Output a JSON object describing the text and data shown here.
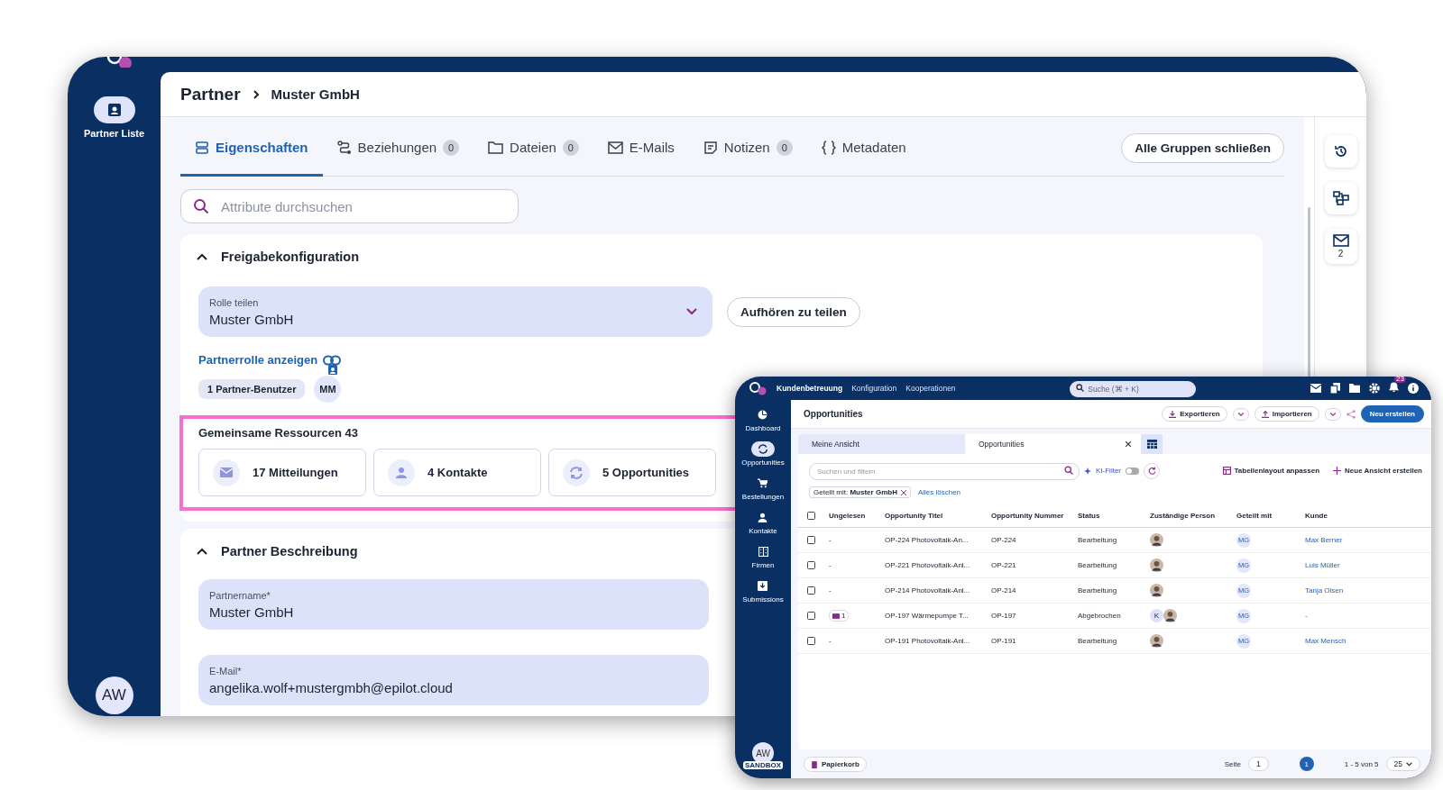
{
  "main": {
    "sidebar": {
      "items": [
        {
          "label": "Partner Liste",
          "selected": true
        }
      ],
      "avatar": "AW"
    },
    "breadcrumb": {
      "root": "Partner",
      "current": "Muster GmbH"
    },
    "tabs": [
      {
        "kind": "list",
        "label": "Eigenschaften",
        "selected": true
      },
      {
        "kind": "relations",
        "label": "Beziehungen",
        "count": "0",
        "selected": false
      },
      {
        "kind": "folder",
        "label": "Dateien",
        "count": "0",
        "selected": false
      },
      {
        "kind": "mail",
        "label": "E-Mails",
        "selected": false
      },
      {
        "kind": "note",
        "label": "Notizen",
        "count": "0",
        "selected": false
      },
      {
        "kind": "braces",
        "label": "Metadaten",
        "selected": false
      }
    ],
    "collapse_button": "Alle Gruppen schließen",
    "search": {
      "placeholder": "Attribute durchsuchen"
    },
    "sharing": {
      "title": "Freigabekonfiguration",
      "expanded": true,
      "role_field": {
        "label": "Rolle teilen",
        "value": "Muster GmbH"
      },
      "stop_button": "Aufhören zu teilen",
      "link": "Partnerrolle anzeigen",
      "users_chip": "1 Partner-Benutzer",
      "user_avatar": "MM",
      "resources": {
        "title": "Gemeinsame Ressourcen 43",
        "highlighted": true,
        "items": [
          {
            "kind": "mail",
            "label": "17 Mitteilungen"
          },
          {
            "kind": "contact",
            "label": "4 Kontakte"
          },
          {
            "kind": "cycle",
            "label": "5 Opportunities"
          }
        ]
      }
    },
    "description": {
      "title": "Partner Beschreibung",
      "expanded": true,
      "fields": [
        {
          "label": "Partnername*",
          "value": "Muster GmbH"
        },
        {
          "label": "E-Mail*",
          "value": "angelika.wolf+mustergmbh@epilot.cloud"
        }
      ]
    },
    "rail": [
      {
        "kind": "history"
      },
      {
        "kind": "relations"
      },
      {
        "kind": "mail",
        "count": "2"
      }
    ]
  },
  "inset": {
    "nav": [
      {
        "label": "Kundenbetreuung",
        "selected": true
      },
      {
        "label": "Konfiguration",
        "selected": false
      },
      {
        "label": "Kooperationen",
        "selected": false
      }
    ],
    "search": {
      "placeholder": "Suche (⌘ + K)"
    },
    "notifications": "23",
    "sidebar": [
      {
        "kind": "dashboard",
        "label": "Dashboard",
        "selected": false
      },
      {
        "kind": "cycle",
        "label": "Opportunities",
        "selected": true
      },
      {
        "kind": "cart",
        "label": "Bestellungen",
        "selected": false
      },
      {
        "kind": "contact",
        "label": "Kontakte",
        "selected": false
      },
      {
        "kind": "building",
        "label": "Firmen",
        "selected": false
      },
      {
        "kind": "inbox",
        "label": "Submissions",
        "selected": false
      }
    ],
    "avatar": "AW",
    "avatar_badge": "SANDBOX",
    "title": "Opportunities",
    "export_button": "Exportieren",
    "import_button": "Importieren",
    "create_button": "Neu erstellen",
    "views": [
      {
        "label": "Meine Ansicht",
        "selected": false
      },
      {
        "label": "Opportunities",
        "selected": true
      }
    ],
    "filter": {
      "placeholder": "Suchen und filtern"
    },
    "ai_filter": {
      "label": "KI-Filter",
      "on": false
    },
    "layout_button": "Tabellenlayout anpassen",
    "new_view_button": "Neue Ansicht erstellen",
    "chip": {
      "label": "Geteilt mit:",
      "value": "Muster GmbH"
    },
    "clear_link": "Alles löschen",
    "select_all_checked": false,
    "columns": [
      "Ungelesen",
      "Opportunity Titel",
      "Opportunity Nummer",
      "Status",
      "Zuständige Person",
      "Geteilt mit",
      "Kunde"
    ],
    "rows": [
      {
        "checked": false,
        "unread": {
          "kind": "dash",
          "text": "-"
        },
        "title": "OP-224 Photovoltaik-An...",
        "number": "OP-224",
        "status": "Bearbeitung",
        "assignees": [
          {
            "kind": "photo"
          }
        ],
        "shared": "MG",
        "customer": "Max Berner"
      },
      {
        "checked": false,
        "unread": {
          "kind": "dash",
          "text": "-"
        },
        "title": "OP-221 Photovoltaik-Anl...",
        "number": "OP-221",
        "status": "Bearbeitung",
        "assignees": [
          {
            "kind": "photo"
          }
        ],
        "shared": "MG",
        "customer": "Luis Müller"
      },
      {
        "checked": false,
        "unread": {
          "kind": "dash",
          "text": "-"
        },
        "title": "OP-214 Photovoltaik-Anl...",
        "number": "OP-214",
        "status": "Bearbeitung",
        "assignees": [
          {
            "kind": "photo"
          }
        ],
        "shared": "MG",
        "customer": "Tanja Olsen"
      },
      {
        "checked": false,
        "unread": {
          "kind": "mail",
          "text": "1"
        },
        "title": "OP-197 Wärmepumpe T...",
        "number": "OP-197",
        "status": "Abgebrochen",
        "assignees": [
          {
            "kind": "initials",
            "text": "K"
          },
          {
            "kind": "photo"
          }
        ],
        "shared": "MG",
        "customer": "-"
      },
      {
        "checked": false,
        "unread": {
          "kind": "dash",
          "text": "-"
        },
        "title": "OP-191 Photovoltaik-Anl...",
        "number": "OP-191",
        "status": "Bearbeitung",
        "assignees": [
          {
            "kind": "photo"
          }
        ],
        "shared": "MG",
        "customer": "Max Mensch"
      }
    ],
    "trash_button": "Papierkorb",
    "page_label": "Seite",
    "page_input": "1",
    "current_page": "1",
    "range": "1 - 5 von 5",
    "per_page": "25"
  }
}
